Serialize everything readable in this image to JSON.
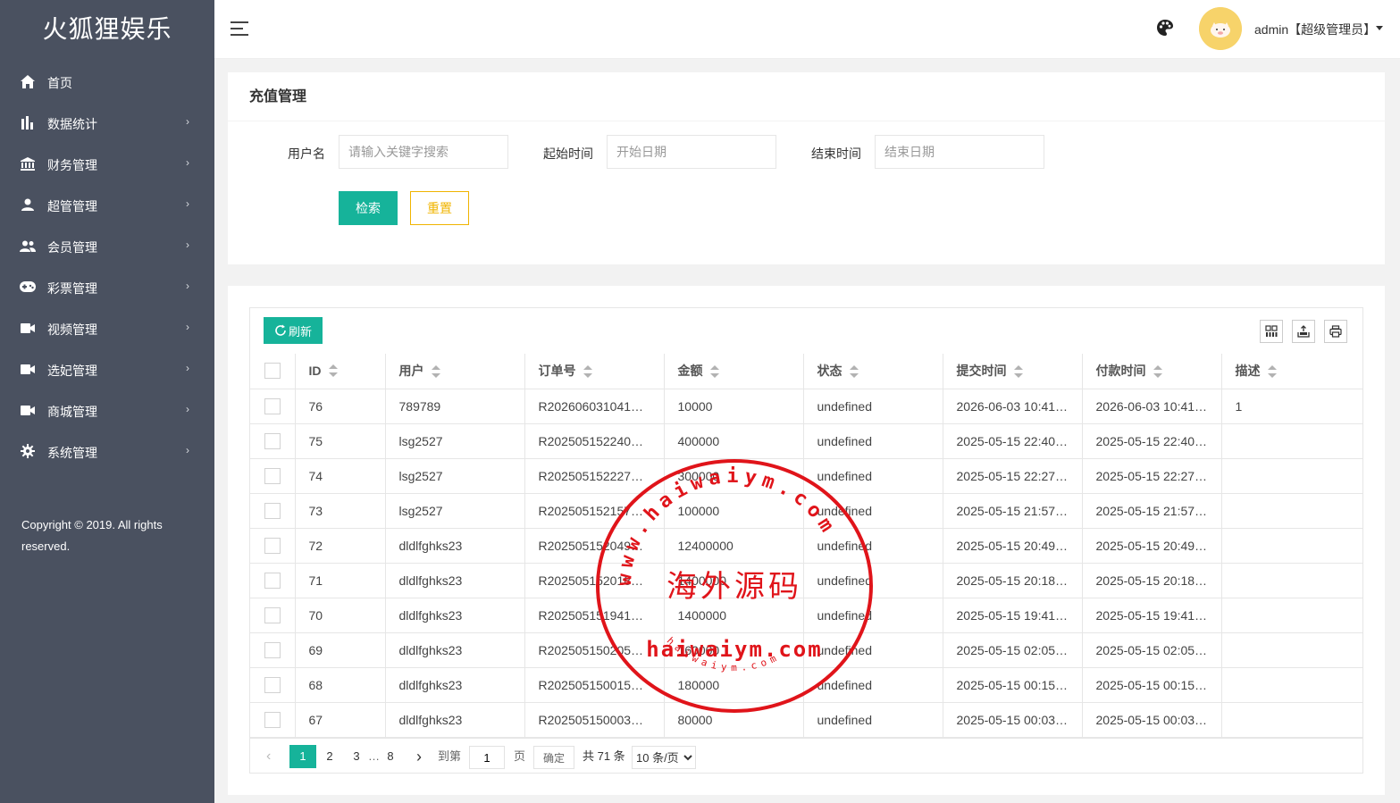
{
  "app": {
    "title": "火狐狸娱乐"
  },
  "sidebar": {
    "items": [
      {
        "label": "首页",
        "icon": "home-icon",
        "has_arrow": false
      },
      {
        "label": "数据统计",
        "icon": "bar-chart-icon",
        "has_arrow": true
      },
      {
        "label": "财务管理",
        "icon": "bank-icon",
        "has_arrow": true
      },
      {
        "label": "超管管理",
        "icon": "user-icon",
        "has_arrow": true
      },
      {
        "label": "会员管理",
        "icon": "users-icon",
        "has_arrow": true
      },
      {
        "label": "彩票管理",
        "icon": "gamepad-icon",
        "has_arrow": true
      },
      {
        "label": "视频管理",
        "icon": "video-icon",
        "has_arrow": true
      },
      {
        "label": "选妃管理",
        "icon": "video-icon",
        "has_arrow": true
      },
      {
        "label": "商城管理",
        "icon": "video-icon",
        "has_arrow": true
      },
      {
        "label": "系统管理",
        "icon": "gear-icon",
        "has_arrow": true
      }
    ],
    "copyright": "Copyright © 2019. All rights reserved."
  },
  "header": {
    "user_label": "admin【超级管理员】"
  },
  "search_card": {
    "title": "充值管理",
    "username_label": "用户名",
    "username_placeholder": "请输入关键字搜索",
    "start_label": "起始时间",
    "start_placeholder": "开始日期",
    "end_label": "结束时间",
    "end_placeholder": "结束日期",
    "search_button": "检索",
    "reset_button": "重置"
  },
  "table": {
    "refresh_button": "刷新",
    "columns": [
      "ID",
      "用户",
      "订单号",
      "金额",
      "状态",
      "提交时间",
      "付款时间",
      "描述"
    ],
    "rows": [
      [
        "76",
        "789789",
        "R202606031041…",
        "10000",
        "undefined",
        "2026-06-03 10:41…",
        "2026-06-03 10:41…",
        "1"
      ],
      [
        "75",
        "lsg2527",
        "R202505152240…",
        "400000",
        "undefined",
        "2025-05-15 22:40…",
        "2025-05-15 22:40…",
        ""
      ],
      [
        "74",
        "lsg2527",
        "R202505152227…",
        "300000",
        "undefined",
        "2025-05-15 22:27…",
        "2025-05-15 22:27…",
        ""
      ],
      [
        "73",
        "lsg2527",
        "R202505152157…",
        "100000",
        "undefined",
        "2025-05-15 21:57…",
        "2025-05-15 21:57…",
        ""
      ],
      [
        "72",
        "dldlfghks23",
        "R202505152049…",
        "12400000",
        "undefined",
        "2025-05-15 20:49…",
        "2025-05-15 20:49…",
        ""
      ],
      [
        "71",
        "dldlfghks23",
        "R202505152018…",
        "1400000",
        "undefined",
        "2025-05-15 20:18…",
        "2025-05-15 20:18…",
        ""
      ],
      [
        "70",
        "dldlfghks23",
        "R202505151941…",
        "1400000",
        "undefined",
        "2025-05-15 19:41…",
        "2025-05-15 19:41…",
        ""
      ],
      [
        "69",
        "dldlfghks23",
        "R202505150205…",
        "160000",
        "undefined",
        "2025-05-15 02:05…",
        "2025-05-15 02:05…",
        ""
      ],
      [
        "68",
        "dldlfghks23",
        "R202505150015…",
        "180000",
        "undefined",
        "2025-05-15 00:15…",
        "2025-05-15 00:15…",
        ""
      ],
      [
        "67",
        "dldlfghks23",
        "R202505150003…",
        "80000",
        "undefined",
        "2025-05-15 00:03…",
        "2025-05-15 00:03…",
        ""
      ]
    ]
  },
  "pagination": {
    "pages": [
      "1",
      "2",
      "3",
      "…",
      "8"
    ],
    "current": "1",
    "goto_label": "到第",
    "goto_value": "1",
    "page_unit": "页",
    "confirm": "确定",
    "total": "共 71 条",
    "per_page": "10 条/页"
  },
  "watermark": {
    "top_arc": "www.haiwaiym.com",
    "center": "海外源码",
    "domain": "haiwaiym.com",
    "bottom_arc": "haiwaiym.com"
  }
}
